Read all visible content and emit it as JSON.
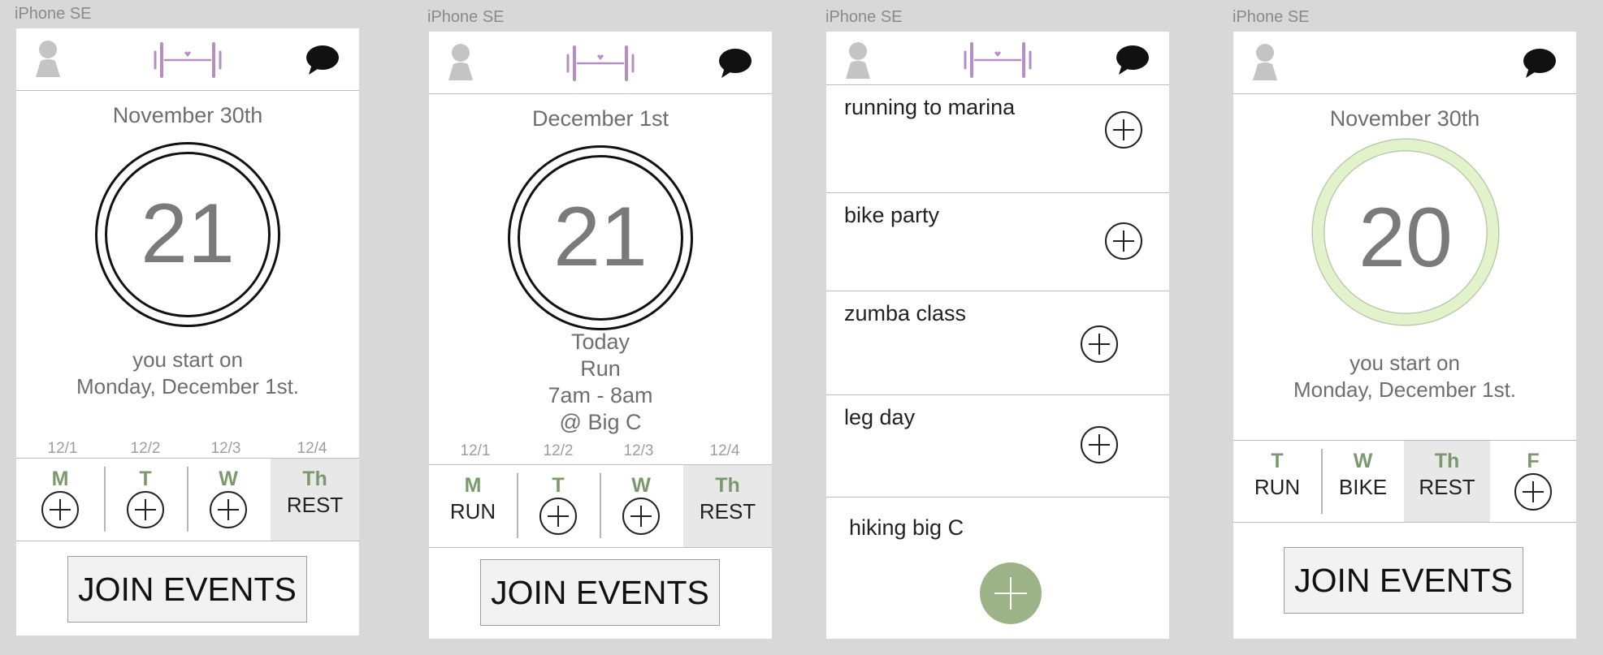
{
  "device_label": "iPhone SE",
  "screens": [
    {
      "date_title": "November 30th",
      "day_count": "21",
      "start_line1": "you start on",
      "start_line2": "Monday, December 1st.",
      "dates": [
        "12/1",
        "12/2",
        "12/3",
        "12/4"
      ],
      "days": [
        {
          "letter": "M",
          "activity": ""
        },
        {
          "letter": "T",
          "activity": ""
        },
        {
          "letter": "W",
          "activity": ""
        },
        {
          "letter": "Th",
          "activity": "REST"
        }
      ],
      "join_label": "JOIN EVENTS"
    },
    {
      "date_title": "December 1st",
      "day_count": "21",
      "today_lines": [
        "Today",
        "Run",
        "7am - 8am",
        "@ Big C"
      ],
      "dates": [
        "12/1",
        "12/2",
        "12/3",
        "12/4"
      ],
      "days": [
        {
          "letter": "M",
          "activity": "RUN"
        },
        {
          "letter": "T",
          "activity": ""
        },
        {
          "letter": "W",
          "activity": ""
        },
        {
          "letter": "Th",
          "activity": "REST"
        }
      ],
      "join_label": "JOIN EVENTS"
    },
    {
      "events": [
        {
          "name": "running to marina"
        },
        {
          "name": "bike party"
        },
        {
          "name": "zumba class"
        },
        {
          "name": "leg day"
        },
        {
          "name": "hiking big C"
        }
      ]
    },
    {
      "date_title": "November 30th",
      "day_count": "20",
      "start_line1": "you start on",
      "start_line2": "Monday, December 1st.",
      "days": [
        {
          "letter": "T",
          "activity": "RUN"
        },
        {
          "letter": "W",
          "activity": "BIKE"
        },
        {
          "letter": "Th",
          "activity": "REST"
        },
        {
          "letter": "F",
          "activity": ""
        }
      ],
      "join_label": "JOIN EVENTS"
    }
  ],
  "colors": {
    "background": "#d8d8d8",
    "logo_accent": "#b88cc4",
    "day_letter": "#7a9a6e",
    "rest_cell": "#e8e8e8",
    "ring_progress": "#e2f3cc",
    "fab": "#9bb386"
  },
  "icons": [
    "avatar-icon",
    "logo-icon",
    "chat-icon",
    "plus-icon"
  ]
}
